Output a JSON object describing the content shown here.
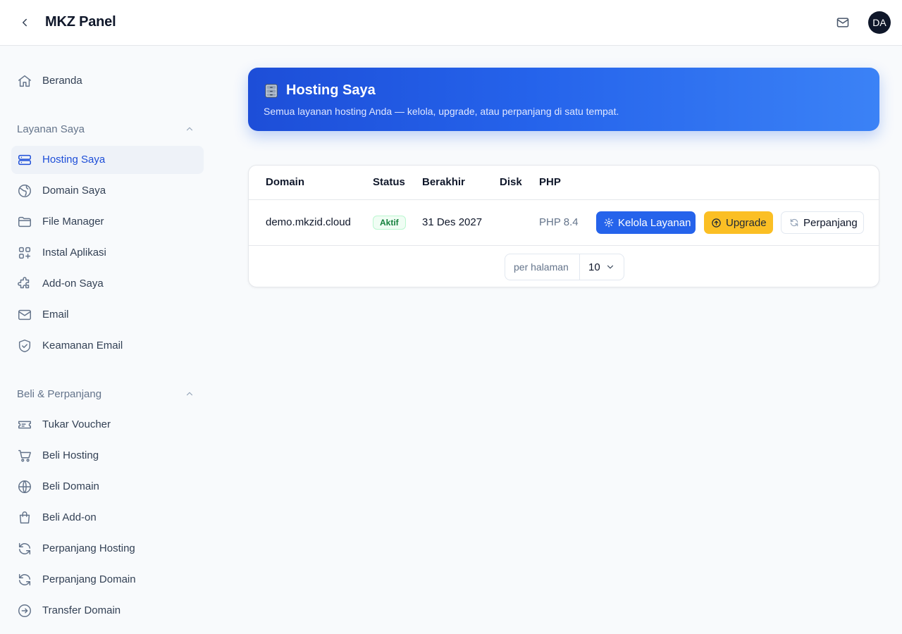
{
  "header": {
    "title": "MKZ Panel",
    "avatar_initials": "DA"
  },
  "sidebar": {
    "home": "Beranda",
    "section_services": "Layanan Saya",
    "services": [
      {
        "label": "Hosting Saya",
        "icon": "server-icon",
        "active": true
      },
      {
        "label": "Domain Saya",
        "icon": "globe-icon"
      },
      {
        "label": "File Manager",
        "icon": "folder-icon"
      },
      {
        "label": "Instal Aplikasi",
        "icon": "apps-icon"
      },
      {
        "label": "Add-on Saya",
        "icon": "puzzle-icon"
      },
      {
        "label": "Email",
        "icon": "mail-icon"
      },
      {
        "label": "Keamanan Email",
        "icon": "shield-icon"
      }
    ],
    "section_buy": "Beli & Perpanjang",
    "buy": [
      {
        "label": "Tukar Voucher",
        "icon": "ticket-icon"
      },
      {
        "label": "Beli Hosting",
        "icon": "cart-icon"
      },
      {
        "label": "Beli Domain",
        "icon": "globe-icon"
      },
      {
        "label": "Beli Add-on",
        "icon": "bag-icon"
      },
      {
        "label": "Perpanjang Hosting",
        "icon": "refresh-icon"
      },
      {
        "label": "Perpanjang Domain",
        "icon": "refresh-icon"
      },
      {
        "label": "Transfer Domain",
        "icon": "arrow-circle-icon"
      }
    ]
  },
  "hero": {
    "title": "Hosting Saya",
    "subtitle": "Semua layanan hosting Anda — kelola, upgrade, atau perpanjang di satu tempat."
  },
  "table": {
    "columns": [
      "Domain",
      "Status",
      "Berakhir",
      "Disk",
      "PHP"
    ],
    "rows": [
      {
        "domain": "demo.mkzid.cloud",
        "status": "Aktif",
        "expires": "31 Des 2027",
        "disk": "",
        "php": "PHP 8.4"
      }
    ],
    "actions": {
      "manage": "Kelola Layanan",
      "upgrade": "Upgrade",
      "renew": "Perpanjang"
    }
  },
  "pagination": {
    "per_page_label": "per halaman",
    "per_page_value": "10"
  },
  "colors": {
    "primary": "#2563eb",
    "accent_yellow": "#fbbf24",
    "status_green": "#15803d"
  }
}
